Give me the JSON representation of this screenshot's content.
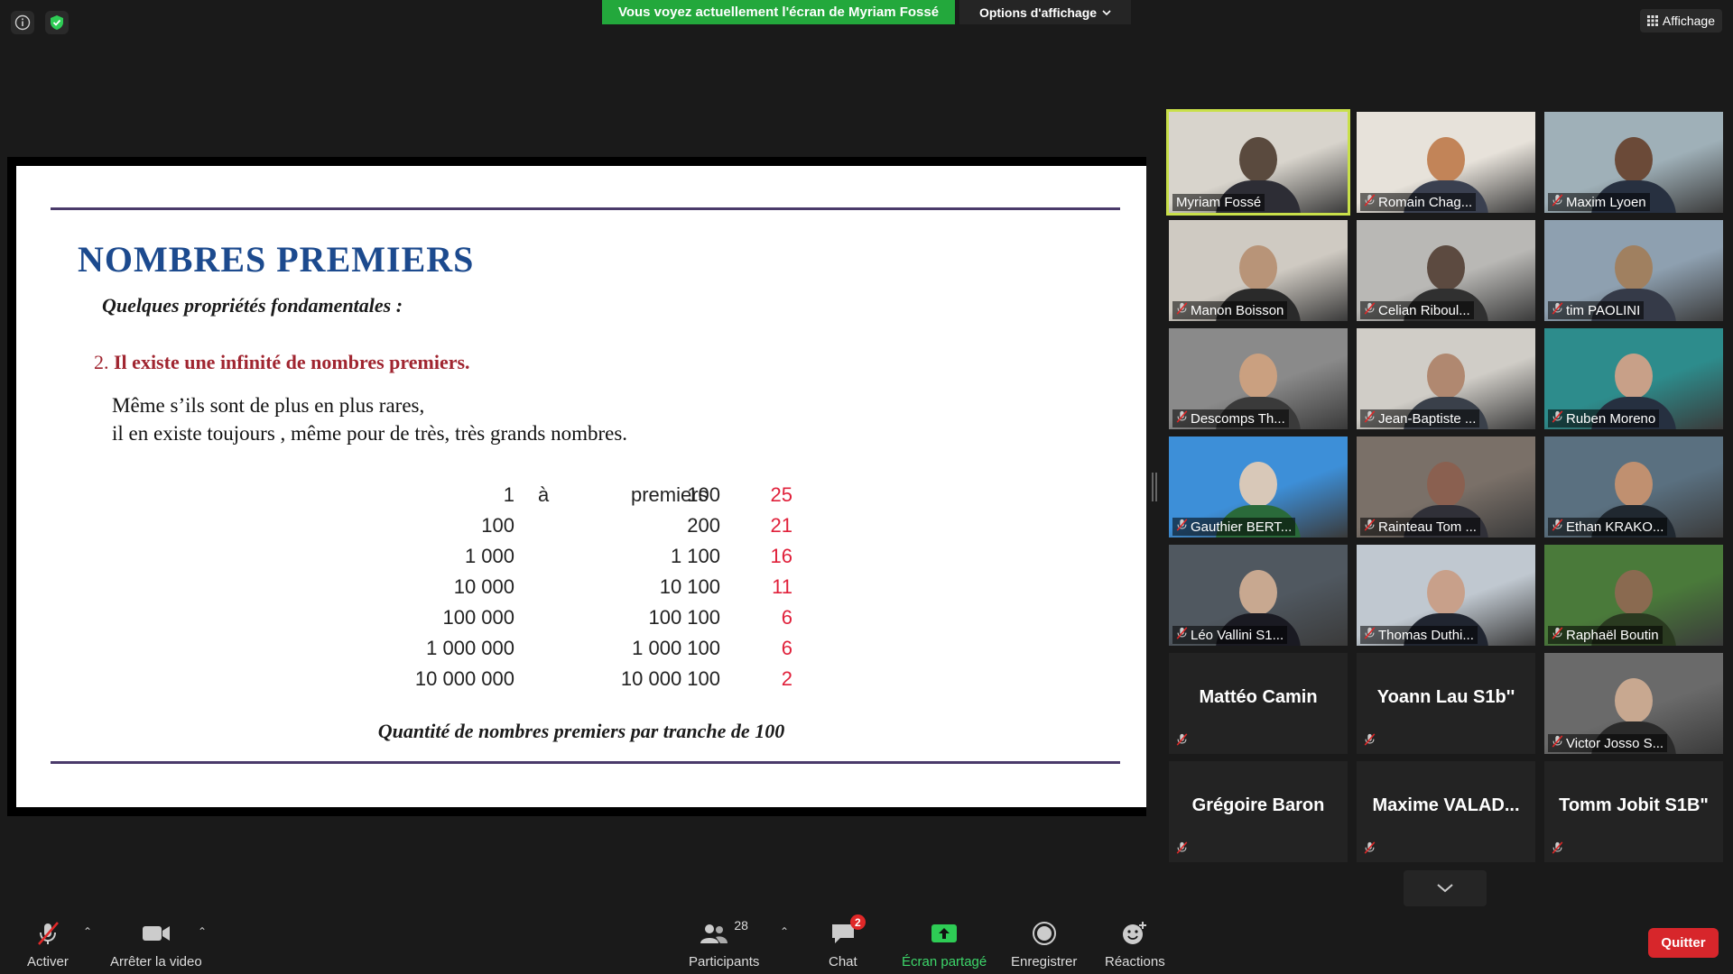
{
  "banner": {
    "sharing_text": "Vous voyez actuellement l'écran de Myriam Fossé",
    "view_options": "Options d'affichage",
    "layout_button": "Affichage"
  },
  "slide": {
    "title": "NOMBRES PREMIERS",
    "subtitle": "Quelques propriétés fondamentales :",
    "point_number": "2.",
    "point_text": "Il existe une infinité de nombres premiers.",
    "body_line1": "Même s’ils sont de plus en plus rares,",
    "body_line2": "il en existe toujours , même pour de très, très grands nombres.",
    "table": {
      "from_label": "à",
      "unit_label": "premiers",
      "rows": [
        {
          "from": "1",
          "to": "100",
          "count": "25"
        },
        {
          "from": "100",
          "to": "200",
          "count": "21"
        },
        {
          "from": "1 000",
          "to": "1 100",
          "count": "16"
        },
        {
          "from": "10 000",
          "to": "10 100",
          "count": "11"
        },
        {
          "from": "100 000",
          "to": "100 100",
          "count": "6"
        },
        {
          "from": "1 000 000",
          "to": "1 000 100",
          "count": "6"
        },
        {
          "from": "10 000 000",
          "to": "10 000 100",
          "count": "2"
        }
      ]
    },
    "caption": "Quantité de nombres premiers par tranche de 100"
  },
  "participants_grid": [
    {
      "name": "Myriam Fossé",
      "muted": false,
      "active": true
    },
    {
      "name": "Romain Chag...",
      "muted": true
    },
    {
      "name": "Maxim Lyoen",
      "muted": true
    },
    {
      "name": "Manon Boisson",
      "muted": true
    },
    {
      "name": "Celian Riboul...",
      "muted": true
    },
    {
      "name": "tim PAOLINI",
      "muted": true
    },
    {
      "name": "Descomps Th...",
      "muted": true
    },
    {
      "name": "Jean-Baptiste ...",
      "muted": true
    },
    {
      "name": "Ruben Moreno",
      "muted": true
    },
    {
      "name": "Gauthier BERT...",
      "muted": true
    },
    {
      "name": "Rainteau Tom ...",
      "muted": true
    },
    {
      "name": "Ethan KRAKO...",
      "muted": true
    },
    {
      "name": "Léo Vallini S1...",
      "muted": true
    },
    {
      "name": "Thomas Duthi...",
      "muted": true
    },
    {
      "name": "Raphaël Boutin",
      "muted": true
    },
    {
      "name": "Mattéo Camin",
      "muted": true,
      "video": false
    },
    {
      "name": "Yoann Lau S1b''",
      "muted": true,
      "video": false
    },
    {
      "name": "Victor Josso S...",
      "muted": true
    },
    {
      "name": "Grégoire Baron",
      "muted": true,
      "video": false
    },
    {
      "name": "Maxime  VALAD...",
      "muted": true,
      "video": false
    },
    {
      "name": "Tomm Jobit S1B\"",
      "muted": true,
      "video": false
    }
  ],
  "toolbar": {
    "unmute": "Activer",
    "stop_video": "Arrêter la video",
    "participants": "Participants",
    "participants_count": "28",
    "chat": "Chat",
    "chat_badge": "2",
    "share_screen": "Écran partagé",
    "record": "Enregistrer",
    "reactions": "Réactions",
    "quit": "Quitter"
  },
  "colors": {
    "share_green": "#23a83c",
    "slide_title": "#1c4a8e",
    "slide_point": "#a02530",
    "count_red": "#e0203a",
    "active_speaker": "#c9e04a",
    "quit_red": "#d7262b"
  }
}
